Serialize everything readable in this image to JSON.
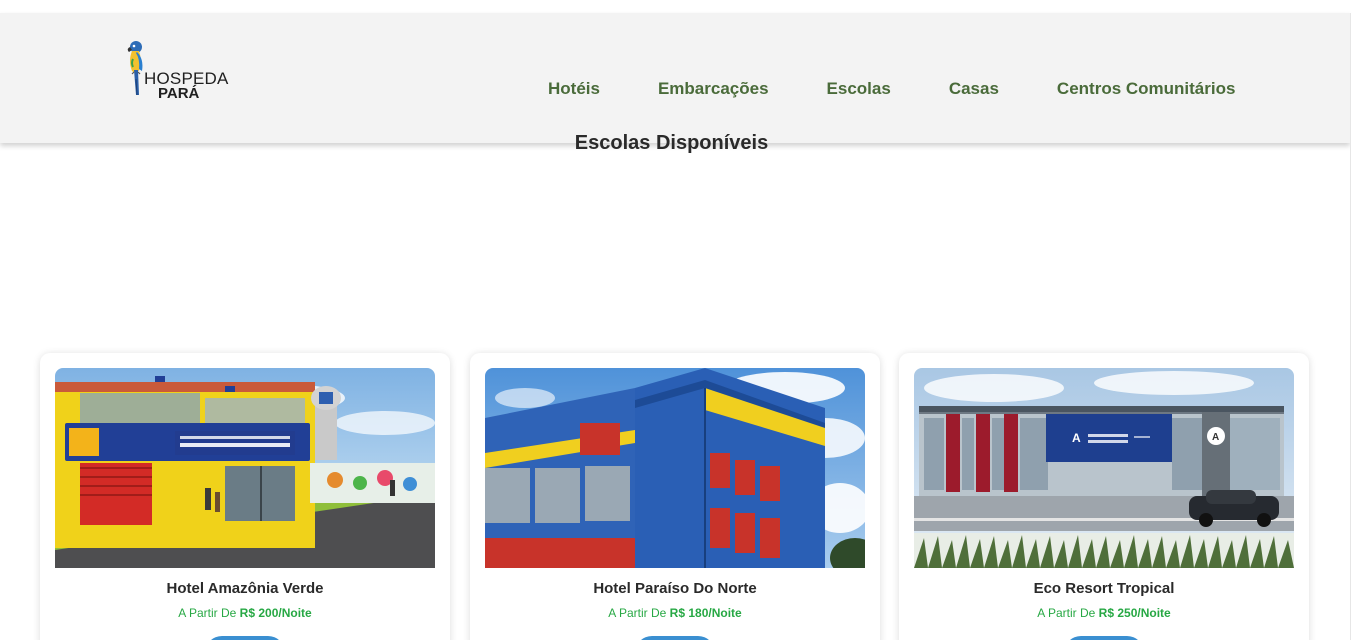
{
  "brand": {
    "line1": "HOSPEDA",
    "line2": "PARÁ",
    "icon": "parrot-icon"
  },
  "nav": {
    "items": [
      {
        "label": "Hotéis"
      },
      {
        "label": "Embarcações"
      },
      {
        "label": "Escolas"
      },
      {
        "label": "Casas"
      },
      {
        "label": "Centros Comunitários"
      }
    ]
  },
  "page": {
    "title": "Escolas Disponíveis"
  },
  "cards": [
    {
      "name": "Hotel Amazônia Verde",
      "price_prefix": "A Partir De",
      "price": "R$ 200/Noite"
    },
    {
      "name": "Hotel Paraíso Do Norte",
      "price_prefix": "A Partir De",
      "price": "R$ 180/Noite"
    },
    {
      "name": "Eco Resort Tropical",
      "price_prefix": "A Partir De",
      "price": "R$ 250/Noite"
    }
  ],
  "colors": {
    "nav_text": "#4a6b3a",
    "price_text": "#27a844",
    "button": "#3a8fd1",
    "header_bg": "#f3f3f3"
  }
}
